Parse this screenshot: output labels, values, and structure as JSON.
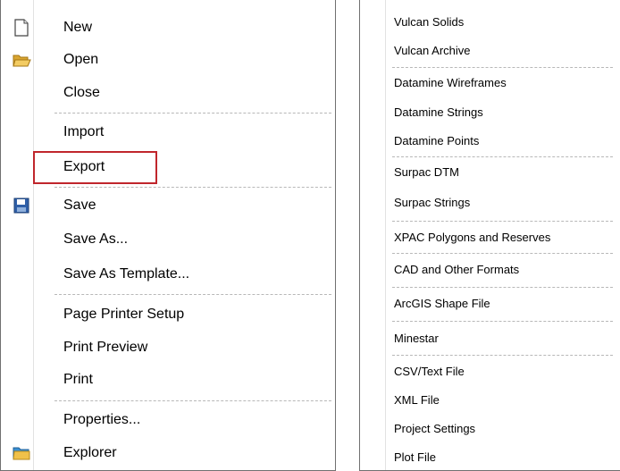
{
  "file_menu": {
    "items": [
      {
        "label": "New",
        "icon": "new-document-icon"
      },
      {
        "label": "Open",
        "icon": "open-folder-icon"
      },
      {
        "label": "Close"
      },
      {
        "label": "Import"
      },
      {
        "label": "Export"
      },
      {
        "label": "Save",
        "icon": "floppy-disk-icon"
      },
      {
        "label": "Save As..."
      },
      {
        "label": "Save As Template..."
      },
      {
        "label": "Page Printer Setup"
      },
      {
        "label": "Print Preview"
      },
      {
        "label": "Print"
      },
      {
        "label": "Properties..."
      },
      {
        "label": "Explorer",
        "icon": "explorer-folder-icon"
      }
    ],
    "highlighted_item": "Export",
    "highlight_color": "#c0262c"
  },
  "export_menu": {
    "items": [
      {
        "label": "Vulcan Solids"
      },
      {
        "label": "Vulcan Archive"
      },
      {
        "label": "Datamine Wireframes"
      },
      {
        "label": "Datamine Strings"
      },
      {
        "label": "Datamine Points"
      },
      {
        "label": "Surpac DTM"
      },
      {
        "label": "Surpac Strings"
      },
      {
        "label": "XPAC Polygons and Reserves"
      },
      {
        "label": "CAD and Other Formats"
      },
      {
        "label": "ArcGIS Shape File"
      },
      {
        "label": "Minestar"
      },
      {
        "label": "CSV/Text File"
      },
      {
        "label": "XML File"
      },
      {
        "label": "Project Settings"
      },
      {
        "label": "Plot File"
      }
    ]
  }
}
